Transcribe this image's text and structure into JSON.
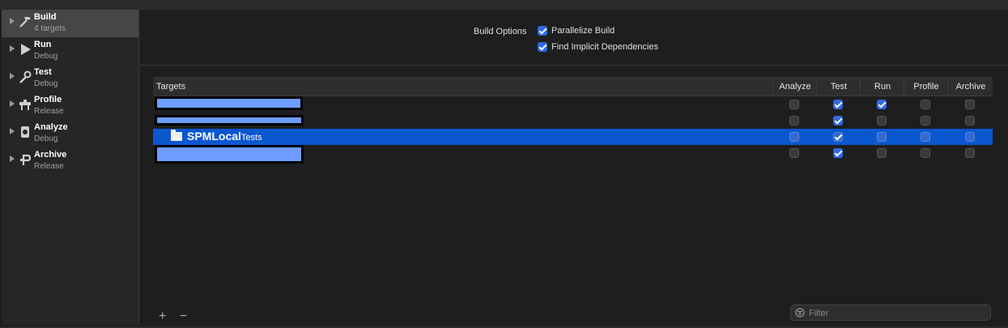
{
  "sidebar": {
    "items": [
      {
        "title": "Build",
        "subtitle": "4 targets",
        "icon": "hammer-icon",
        "selected": true
      },
      {
        "title": "Run",
        "subtitle": "Debug",
        "icon": "play-icon",
        "selected": false
      },
      {
        "title": "Test",
        "subtitle": "Debug",
        "icon": "wrench-icon",
        "selected": false
      },
      {
        "title": "Profile",
        "subtitle": "Release",
        "icon": "instruments-icon",
        "selected": false
      },
      {
        "title": "Analyze",
        "subtitle": "Debug",
        "icon": "analyze-icon",
        "selected": false
      },
      {
        "title": "Archive",
        "subtitle": "Release",
        "icon": "archive-icon",
        "selected": false
      }
    ]
  },
  "build_options": {
    "label": "Build Options",
    "parallelize": {
      "label": "Parallelize Build",
      "checked": true
    },
    "implicit": {
      "label": "Find Implicit Dependencies",
      "checked": true
    }
  },
  "table": {
    "headers": {
      "targets": "Targets",
      "analyze": "Analyze",
      "test": "Test",
      "run": "Run",
      "profile": "Profile",
      "archive": "Archive"
    },
    "rows": [
      {
        "name": "",
        "redacted": true,
        "analyze": false,
        "test": true,
        "run": true,
        "profile": false,
        "archive": false
      },
      {
        "name": "",
        "redacted": true,
        "analyze": false,
        "test": true,
        "run": false,
        "profile": false,
        "archive": false
      },
      {
        "name_main": "SPMLocal",
        "name_suffix": "Tests",
        "redacted": false,
        "selected": true,
        "analyze": false,
        "test": true,
        "run": false,
        "profile": false,
        "archive": false
      },
      {
        "name": "",
        "redacted": true,
        "analyze": false,
        "test": true,
        "run": false,
        "profile": false,
        "archive": false
      }
    ]
  },
  "footer": {
    "add_label": "+",
    "remove_label": "−",
    "filter_placeholder": "Filter",
    "filter_icon": "filter-icon"
  },
  "colors": {
    "accent": "#2d6ae3",
    "selection": "#0a57d0",
    "redaction": "#6e9cff"
  }
}
